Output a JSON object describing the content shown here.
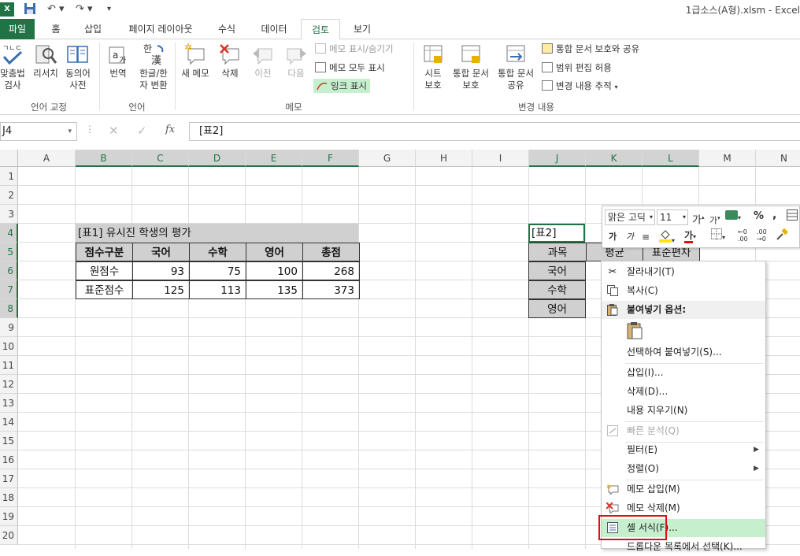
{
  "titlebar": {
    "title": "1급소스(A형).xlsm - Excel",
    "app_icon": "X"
  },
  "tabs": {
    "file": "파일",
    "home": "홈",
    "insert": "삽입",
    "page_layout": "페이지 레이아웃",
    "formulas": "수식",
    "data": "데이터",
    "review": "검토",
    "view": "보기"
  },
  "ribbon": {
    "spelling": "맞춤법\n검사",
    "research": "리서치",
    "thesaurus": "동의어\n사전",
    "translate": "번역",
    "hanja": "한글/한\n자 변환",
    "new_comment": "새 메모",
    "delete": "삭제",
    "previous": "이전",
    "next": "다음",
    "show_hide": "메모 표시/숨기기",
    "show_all": "메모 모두 표시",
    "show_ink": "잉크 표시",
    "protect_sheet": "시트\n보호",
    "protect_workbook": "통합 문서\n보호",
    "share_workbook": "통합 문서\n공유",
    "protect_share": "통합 문서 보호와 공유",
    "allow_edit": "범위 편집 허용",
    "track_changes": "변경 내용 추적",
    "group_proofing": "언어 교정",
    "group_language": "언어",
    "group_comments": "메모",
    "group_changes": "변경 내용"
  },
  "formula_bar": {
    "name_box": "J4",
    "content": "[표2]",
    "fx": "fx"
  },
  "columns": [
    "A",
    "B",
    "C",
    "D",
    "E",
    "F",
    "G",
    "H",
    "I",
    "J",
    "K",
    "L",
    "M",
    "N"
  ],
  "rows": [
    "1",
    "2",
    "3",
    "4",
    "5",
    "6",
    "7",
    "8",
    "9",
    "10",
    "11",
    "12",
    "13",
    "14",
    "15",
    "16",
    "17",
    "18",
    "19",
    "20"
  ],
  "table1": {
    "title": "[표1] 유시진 학생의 평가",
    "headers": [
      "점수구분",
      "국어",
      "수학",
      "영어",
      "총점"
    ],
    "rows": [
      [
        "원점수",
        "93",
        "75",
        "100",
        "268"
      ],
      [
        "표준점수",
        "125",
        "113",
        "135",
        "373"
      ]
    ]
  },
  "table2": {
    "title": "[표2]",
    "headers": [
      "과목",
      "평균",
      "표준편차"
    ],
    "subjects": [
      "국어",
      "수학",
      "영어"
    ]
  },
  "mini_toolbar": {
    "font": "맑은 고딕",
    "size": "11",
    "grow": "가",
    "shrink": "가",
    "percent": "%",
    "comma": ",",
    "bold": "가",
    "italic": "가",
    "font_color_glyph": "가"
  },
  "context_menu": {
    "cut": "잘라내기(T)",
    "copy": "복사(C)",
    "paste_options": "붙여넣기 옵션:",
    "paste_special": "선택하여 붙여넣기(S)...",
    "insert": "삽입(I)...",
    "delete": "삭제(D)...",
    "clear": "내용 지우기(N)",
    "quick_analysis": "빠른 분석(Q)",
    "filter": "필터(E)",
    "sort": "정렬(O)",
    "insert_comment": "메모 삽입(M)",
    "delete_comment": "메모 삭제(M)",
    "format_cells": "셀 서식(F)...",
    "pick_list": "드롭다운 목록에서 선택(K)..."
  }
}
